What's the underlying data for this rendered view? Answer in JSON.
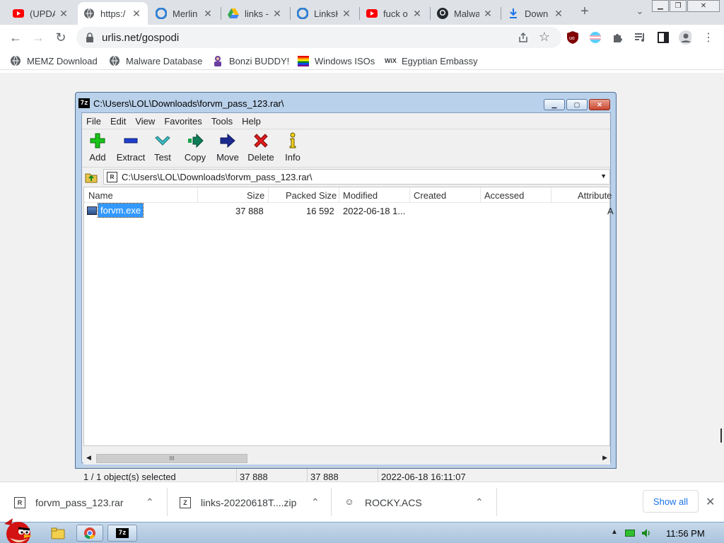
{
  "browser": {
    "tabs": [
      {
        "title": "(UPDA",
        "icon": "youtube-icon",
        "active": false
      },
      {
        "title": "https:/",
        "icon": "globe-icon",
        "active": true
      },
      {
        "title": "Merlin",
        "icon": "linkstack-icon",
        "active": false
      },
      {
        "title": "links -",
        "icon": "google-drive-icon",
        "active": false
      },
      {
        "title": "LinksK",
        "icon": "linkstack-icon",
        "active": false
      },
      {
        "title": "fuck o",
        "icon": "youtube-icon",
        "active": false
      },
      {
        "title": "Malwa",
        "icon": "github-icon",
        "active": false
      },
      {
        "title": "Down",
        "icon": "download-icon",
        "active": false
      }
    ],
    "new_tab": "+",
    "url": "urlis.net/gospodi",
    "bookmarks": [
      {
        "label": "MEMZ Download",
        "icon": "globe-icon"
      },
      {
        "label": "Malware Database",
        "icon": "globe-icon"
      },
      {
        "label": "Bonzi BUDDY!",
        "icon": "bonzi-icon"
      },
      {
        "label": "Windows ISOs",
        "icon": "rainbow-flag-icon"
      },
      {
        "label": "Egyptian Embassy",
        "icon": "wix-icon"
      }
    ]
  },
  "sevenzip": {
    "title": "C:\\Users\\LOL\\Downloads\\forvm_pass_123.rar\\",
    "menu": [
      "File",
      "Edit",
      "View",
      "Favorites",
      "Tools",
      "Help"
    ],
    "toolbar": [
      "Add",
      "Extract",
      "Test",
      "Copy",
      "Move",
      "Delete",
      "Info"
    ],
    "address": "C:\\Users\\LOL\\Downloads\\forvm_pass_123.rar\\",
    "columns": [
      "Name",
      "Size",
      "Packed Size",
      "Modified",
      "Created",
      "Accessed",
      "Attribute"
    ],
    "files": [
      {
        "name": "forvm.exe",
        "size": "37 888",
        "packed": "16 592",
        "modified": "2022-06-18 1...",
        "created": "",
        "accessed": "",
        "attr": "A"
      }
    ],
    "status": {
      "selected": "1 / 1 object(s) selected",
      "size": "37 888",
      "packed": "37 888",
      "modified": "2022-06-18 16:11:07"
    },
    "scroll_thumb": "III"
  },
  "downloads": {
    "items": [
      {
        "name": "forvm_pass_123.rar",
        "icon": "rar-icon"
      },
      {
        "name": "links-20220618T....zip",
        "icon": "zip-icon"
      },
      {
        "name": "ROCKY.ACS",
        "icon": "agent-icon"
      }
    ],
    "show_all": "Show all"
  },
  "taskbar": {
    "clock": "11:56 PM",
    "app_label": "7z"
  },
  "colors": {
    "selection": "#3399ff",
    "link_blue": "#1a73e8",
    "window_frame": "#b9d1ea"
  }
}
